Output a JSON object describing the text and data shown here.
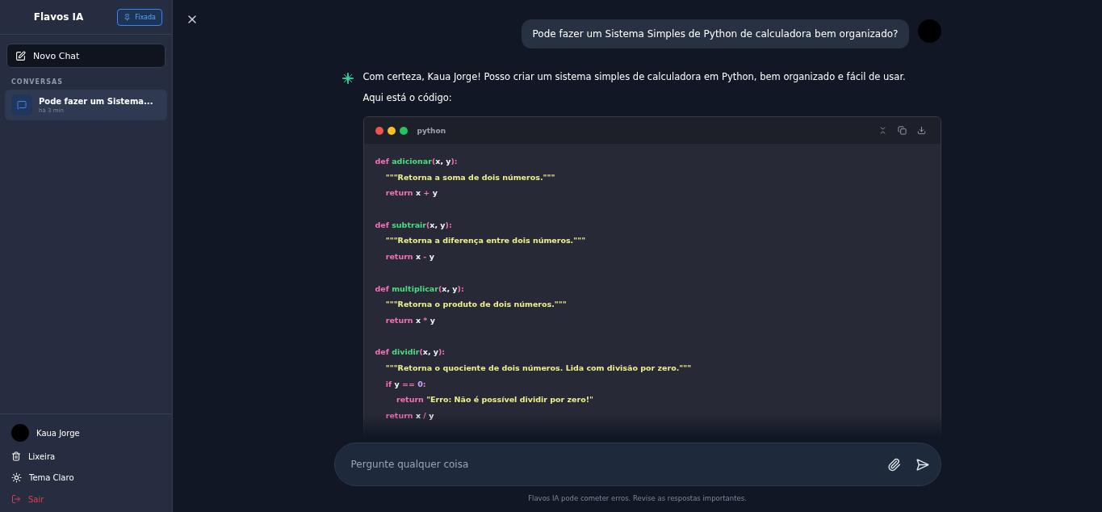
{
  "sidebar": {
    "title": "Flavos IA",
    "pin_button": {
      "label": "Fixada",
      "selected": true
    },
    "new_chat": "Novo Chat",
    "section_label": "CONVERSAS",
    "conversations": [
      {
        "title": "Pode fazer um Sistema...",
        "time": "há 3 min",
        "selected": true
      }
    ],
    "user": {
      "name": "Kaua Jorge"
    },
    "menu": [
      {
        "kind": "trash",
        "label": "Lixeira"
      },
      {
        "kind": "theme",
        "label": "Tema Claro"
      },
      {
        "kind": "logout",
        "label": "Sair"
      }
    ]
  },
  "chat": {
    "user_message": "Pode fazer um Sistema Simples de Python de calculadora bem organizado?",
    "assistant_paragraphs": [
      "Com certeza, Kaua Jorge! Posso criar um sistema simples de calculadora em Python, bem organizado e fácil de usar.",
      "Aqui está o código:"
    ],
    "code": {
      "language": "python",
      "lines": [
        {
          "kind": "code",
          "tokens": [
            {
              "kind": "kw",
              "text": "def "
            },
            {
              "kind": "fn",
              "text": "adicionar"
            },
            {
              "kind": "p",
              "text": "("
            },
            {
              "kind": "id",
              "text": "x, y"
            },
            {
              "kind": "p",
              "text": "):"
            }
          ]
        },
        {
          "kind": "code",
          "tokens": [
            {
              "kind": "str",
              "text": "    \"\"\"Retorna a soma de dois números.\"\"\""
            }
          ]
        },
        {
          "kind": "code",
          "tokens": [
            {
              "kind": "kw",
              "text": "    return "
            },
            {
              "kind": "id",
              "text": "x "
            },
            {
              "kind": "p",
              "text": "+ "
            },
            {
              "kind": "id",
              "text": "y"
            }
          ]
        },
        {
          "kind": "blank"
        },
        {
          "kind": "code",
          "tokens": [
            {
              "kind": "kw",
              "text": "def "
            },
            {
              "kind": "fn",
              "text": "subtrair"
            },
            {
              "kind": "p",
              "text": "("
            },
            {
              "kind": "id",
              "text": "x, y"
            },
            {
              "kind": "p",
              "text": "):"
            }
          ]
        },
        {
          "kind": "code",
          "tokens": [
            {
              "kind": "str",
              "text": "    \"\"\"Retorna a diferença entre dois números.\"\"\""
            }
          ]
        },
        {
          "kind": "code",
          "tokens": [
            {
              "kind": "kw",
              "text": "    return "
            },
            {
              "kind": "id",
              "text": "x "
            },
            {
              "kind": "p",
              "text": "- "
            },
            {
              "kind": "id",
              "text": "y"
            }
          ]
        },
        {
          "kind": "blank"
        },
        {
          "kind": "code",
          "tokens": [
            {
              "kind": "kw",
              "text": "def "
            },
            {
              "kind": "fn",
              "text": "multiplicar"
            },
            {
              "kind": "p",
              "text": "("
            },
            {
              "kind": "id",
              "text": "x, y"
            },
            {
              "kind": "p",
              "text": "):"
            }
          ]
        },
        {
          "kind": "code",
          "tokens": [
            {
              "kind": "str",
              "text": "    \"\"\"Retorna o produto de dois números.\"\"\""
            }
          ]
        },
        {
          "kind": "code",
          "tokens": [
            {
              "kind": "kw",
              "text": "    return "
            },
            {
              "kind": "id",
              "text": "x "
            },
            {
              "kind": "p",
              "text": "* "
            },
            {
              "kind": "id",
              "text": "y"
            }
          ]
        },
        {
          "kind": "blank"
        },
        {
          "kind": "code",
          "tokens": [
            {
              "kind": "kw",
              "text": "def "
            },
            {
              "kind": "fn",
              "text": "dividir"
            },
            {
              "kind": "p",
              "text": "("
            },
            {
              "kind": "id",
              "text": "x, y"
            },
            {
              "kind": "p",
              "text": "):"
            }
          ]
        },
        {
          "kind": "code",
          "tokens": [
            {
              "kind": "str",
              "text": "    \"\"\"Retorna o quociente de dois números. Lida com divisão por zero.\"\"\""
            }
          ]
        },
        {
          "kind": "code",
          "tokens": [
            {
              "kind": "kw",
              "text": "    if "
            },
            {
              "kind": "id",
              "text": "y "
            },
            {
              "kind": "p",
              "text": "== "
            },
            {
              "kind": "num",
              "text": "0"
            },
            {
              "kind": "p",
              "text": ":"
            }
          ]
        },
        {
          "kind": "code",
          "tokens": [
            {
              "kind": "kw",
              "text": "        return "
            },
            {
              "kind": "str",
              "text": "\"Erro: Não é possível dividir por zero!\""
            }
          ]
        },
        {
          "kind": "code",
          "tokens": [
            {
              "kind": "kw",
              "text": "    return "
            },
            {
              "kind": "id",
              "text": "x "
            },
            {
              "kind": "p",
              "text": "/ "
            },
            {
              "kind": "id",
              "text": "y"
            }
          ]
        }
      ]
    }
  },
  "composer": {
    "placeholder": "Pergunte qualquer coisa"
  },
  "disclaimer": "Flavos IA pode cometer erros. Revise as respostas importantes."
}
